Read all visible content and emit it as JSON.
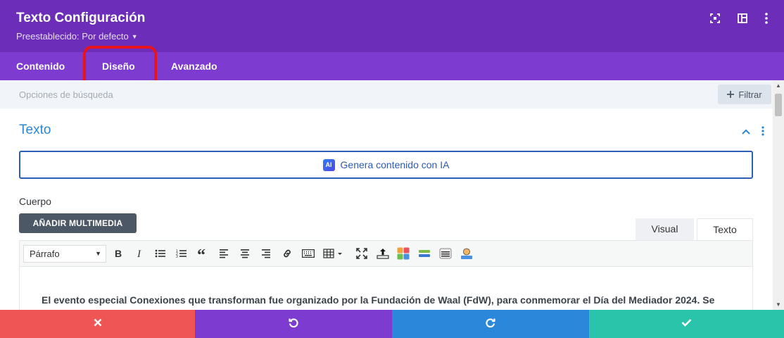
{
  "header": {
    "title": "Texto Configuración",
    "preset": "Preestablecido: Por defecto",
    "icons": [
      "expand-icon",
      "sidebar-layout-icon",
      "more-vertical-icon"
    ]
  },
  "tabs": [
    {
      "label": "Contenido"
    },
    {
      "label": "Diseño"
    },
    {
      "label": "Avanzado"
    }
  ],
  "search": {
    "placeholder": "Opciones de búsqueda",
    "filter_label": "Filtrar"
  },
  "section": {
    "title": "Texto",
    "ai_button": "Genera contenido con IA",
    "ai_badge": "AI",
    "field_label": "Cuerpo",
    "media_button": "AÑADIR MULTIMEDIA"
  },
  "editor": {
    "tabs": {
      "visual": "Visual",
      "text": "Texto"
    },
    "format_select": "Párrafo",
    "content": "El evento especial Conexiones que transforman fue organizado por la Fundación de Waal (FdW), para conmemorar el Día del Mediador 2024. Se"
  },
  "actions": [
    "cancel",
    "undo",
    "redo",
    "save"
  ],
  "colors": {
    "header": "#6c2eb9",
    "tabs": "#7d3bcf",
    "accent_blue": "#2b87da",
    "cancel": "#ef5555",
    "undo": "#7e3bd0",
    "redo": "#2b87da",
    "save": "#29c4a9",
    "highlight": "#e8141c"
  }
}
